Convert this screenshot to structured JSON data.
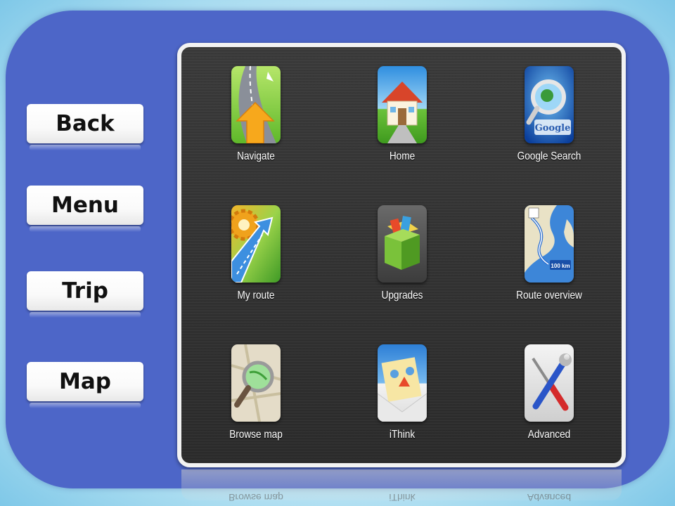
{
  "sidebar": {
    "buttons": [
      {
        "label": "Back"
      },
      {
        "label": "Menu"
      },
      {
        "label": "Trip"
      },
      {
        "label": "Map"
      }
    ]
  },
  "apps": [
    {
      "label": "Navigate",
      "icon": "navigate-road-icon"
    },
    {
      "label": "Home",
      "icon": "home-house-icon"
    },
    {
      "label": "Google Search",
      "icon": "google-search-magnifier-icon"
    },
    {
      "label": "My route",
      "icon": "my-route-gear-icon"
    },
    {
      "label": "Upgrades",
      "icon": "upgrades-box-icon"
    },
    {
      "label": "Route overview",
      "icon": "route-overview-map-icon"
    },
    {
      "label": "Browse map",
      "icon": "browse-map-magnifier-icon"
    },
    {
      "label": "iThink",
      "icon": "ithink-envelope-icon"
    },
    {
      "label": "Advanced",
      "icon": "advanced-tools-icon"
    }
  ],
  "icon_texts": {
    "google": "Google",
    "distance": "100 km"
  },
  "reflection_labels": [
    "Browse map",
    "iThink",
    "Advanced"
  ],
  "colors": {
    "frame": "#4d66c8",
    "panel": "#333333",
    "button": "#ffffff"
  }
}
